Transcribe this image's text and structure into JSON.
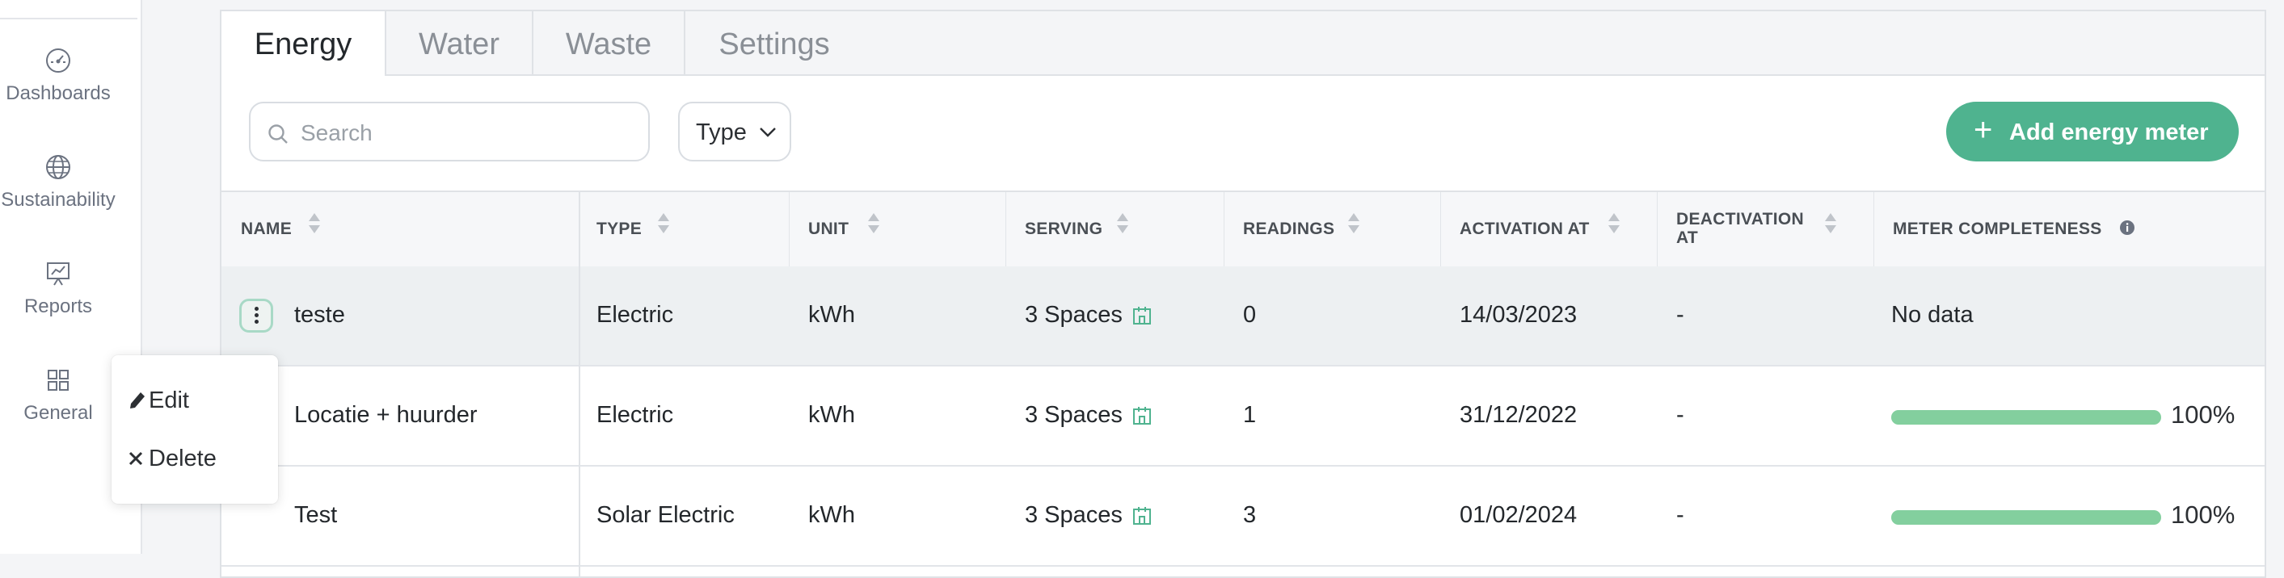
{
  "sidebar": {
    "items": [
      {
        "label": "Dashboards",
        "icon": "gauge-icon"
      },
      {
        "label": "Sustainability",
        "icon": "globe-icon"
      },
      {
        "label": "Reports",
        "icon": "presentation-chart-icon"
      },
      {
        "label": "General",
        "icon": "grid-icon"
      }
    ]
  },
  "tabs": [
    {
      "label": "Energy",
      "active": true
    },
    {
      "label": "Water",
      "active": false
    },
    {
      "label": "Waste",
      "active": false
    },
    {
      "label": "Settings",
      "active": false
    }
  ],
  "toolbar": {
    "search_placeholder": "Search",
    "search_value": "",
    "type_filter_label": "Type",
    "add_button_label": "Add energy meter"
  },
  "table": {
    "columns": [
      "NAME",
      "TYPE",
      "UNIT",
      "SERVING",
      "READINGS",
      "ACTIVATION AT",
      "DEACTIVATION AT",
      "METER COMPLETENESS"
    ],
    "rows": [
      {
        "name": "teste",
        "type": "Electric",
        "unit": "kWh",
        "serving": "3 Spaces",
        "readings": "0",
        "activation": "14/03/2023",
        "deactivation": "-",
        "completeness_text": "No data",
        "completeness": null
      },
      {
        "name": "Locatie + huurder",
        "type": "Electric",
        "unit": "kWh",
        "serving": "3 Spaces",
        "readings": "1",
        "activation": "31/12/2022",
        "deactivation": "-",
        "completeness_text": "100%",
        "completeness": 1.0
      },
      {
        "name": "Test",
        "type": "Solar Electric",
        "unit": "kWh",
        "serving": "3 Spaces",
        "readings": "3",
        "activation": "01/02/2024",
        "deactivation": "-",
        "completeness_text": "100%",
        "completeness": 1.0
      }
    ]
  },
  "context_menu": {
    "items": [
      {
        "label": "Edit",
        "icon": "pencil-icon"
      },
      {
        "label": "Delete",
        "icon": "close-icon"
      }
    ]
  },
  "colors": {
    "accent": "#4fb38f",
    "progress": "#83cf9e",
    "row_highlight": "#edf0f2"
  }
}
